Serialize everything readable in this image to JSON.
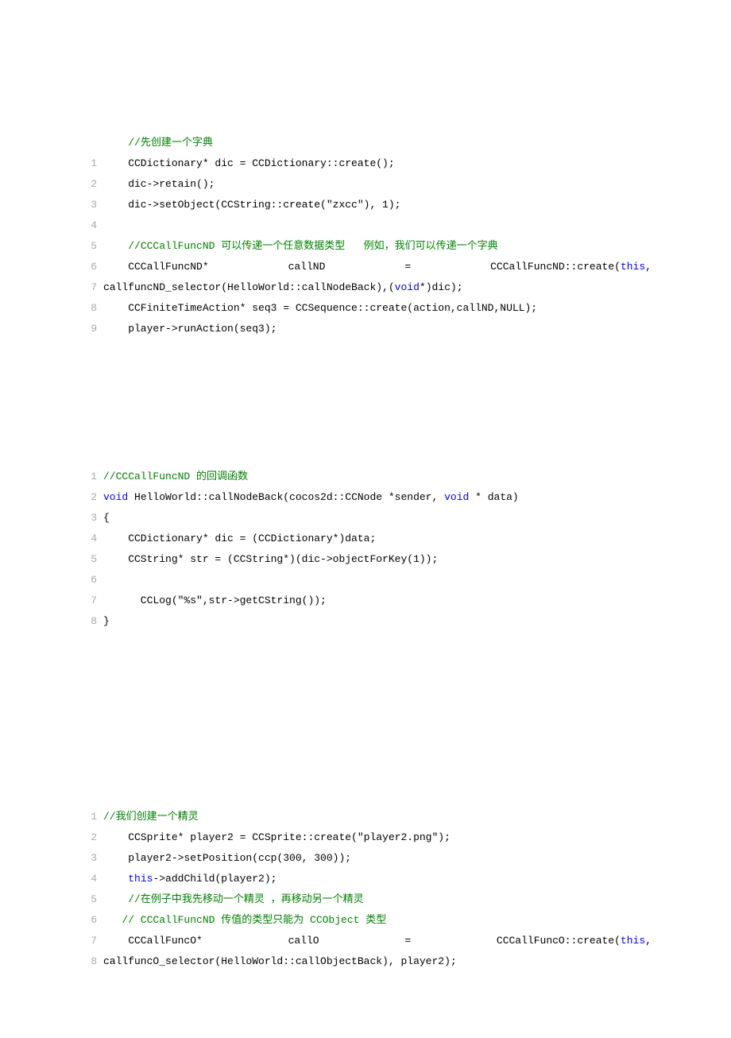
{
  "block1": {
    "pre": {
      "indent": "    ",
      "c": "//先创建一个字典"
    },
    "lines": [
      {
        "ln": "1",
        "type": "plain",
        "indent": "    ",
        "text": "CCDictionary* dic = CCDictionary::create();"
      },
      {
        "ln": "2",
        "type": "plain",
        "indent": "    ",
        "text": "dic->retain();"
      },
      {
        "ln": "3",
        "type": "plain",
        "indent": "    ",
        "text": "dic->setObject(CCString::create(\"zxcc\"), 1);"
      },
      {
        "ln": "4",
        "type": "blank"
      },
      {
        "ln": "5",
        "type": "comment",
        "indent": "    ",
        "text": "//CCCallFuncND 可以传递一个任意数据类型   例如，我们可以传递一个字典"
      },
      {
        "ln": "6",
        "type": "justify",
        "segments": [
          "    CCCallFuncND*",
          "callND",
          "=",
          "CCCallFuncND::create(",
          "this",
          ","
        ],
        "segTypes": [
          "plain",
          "plain",
          "plain",
          "plain",
          "keyword",
          "plain"
        ]
      },
      {
        "ln": "7",
        "type": "mixed",
        "parts": [
          {
            "t": "callfuncND_selector(HelloWorld::callNodeBack),(",
            "cls": ""
          },
          {
            "t": "void",
            "cls": "keyword"
          },
          {
            "t": "*)dic);",
            "cls": ""
          }
        ]
      },
      {
        "ln": "8",
        "type": "plain",
        "indent": "    ",
        "text": "CCFiniteTimeAction* seq3 = CCSequence::create(action,callND,NULL);"
      },
      {
        "ln": "9",
        "type": "plain",
        "indent": "    ",
        "text": "player->runAction(seq3);"
      }
    ]
  },
  "block2": {
    "lines": [
      {
        "ln": "1",
        "type": "comment",
        "indent": "",
        "text": "//CCCallFuncND 的回调函数"
      },
      {
        "ln": "2",
        "type": "mixed",
        "parts": [
          {
            "t": "void",
            "cls": "keyword"
          },
          {
            "t": " HelloWorld::callNodeBack(cocos2d::CCNode *sender, ",
            "cls": ""
          },
          {
            "t": "void",
            "cls": "keyword"
          },
          {
            "t": " * data)",
            "cls": ""
          }
        ]
      },
      {
        "ln": "3",
        "type": "plain",
        "indent": "",
        "text": "{"
      },
      {
        "ln": "4",
        "type": "plain",
        "indent": "    ",
        "text": "CCDictionary* dic = (CCDictionary*)data;"
      },
      {
        "ln": "5",
        "type": "plain",
        "indent": "    ",
        "text": "CCString* str = (CCString*)(dic->objectForKey(1));"
      },
      {
        "ln": "6",
        "type": "blank"
      },
      {
        "ln": "7",
        "type": "plain",
        "indent": "      ",
        "text": "CCLog(\"%s\",str->getCString());"
      },
      {
        "ln": "8",
        "type": "plain",
        "indent": "",
        "text": "}"
      }
    ]
  },
  "block3": {
    "lines": [
      {
        "ln": "1",
        "type": "comment",
        "indent": "",
        "text": "//我们创建一个精灵"
      },
      {
        "ln": "2",
        "type": "plain",
        "indent": "    ",
        "text": "CCSprite* player2 = CCSprite::create(\"player2.png\");"
      },
      {
        "ln": "3",
        "type": "plain",
        "indent": "    ",
        "text": "player2->setPosition(ccp(300, 300));"
      },
      {
        "ln": "4",
        "type": "mixed",
        "parts": [
          {
            "t": "    ",
            "cls": ""
          },
          {
            "t": "this",
            "cls": "keyword"
          },
          {
            "t": "->addChild(player2);",
            "cls": ""
          }
        ]
      },
      {
        "ln": "5",
        "type": "comment",
        "indent": "    ",
        "text": "//在例子中我先移动一个精灵 ，再移动另一个精灵"
      },
      {
        "ln": "6",
        "type": "mixed-comment",
        "parts": [
          {
            "t": "   ",
            "cls": ""
          },
          {
            "t": "// CCCallFuncND 传值的类型只能为 CCObject 类型",
            "cls": "comment"
          }
        ]
      },
      {
        "ln": "7",
        "type": "justify",
        "segments": [
          "    CCCallFuncO*",
          "callO",
          "=",
          "CCCallFuncO::create(",
          "this",
          ","
        ],
        "segTypes": [
          "plain",
          "plain",
          "plain",
          "plain",
          "keyword",
          "plain"
        ]
      },
      {
        "ln": "8",
        "type": "plain",
        "indent": "",
        "text": "callfuncO_selector(HelloWorld::callObjectBack), player2);"
      }
    ]
  }
}
